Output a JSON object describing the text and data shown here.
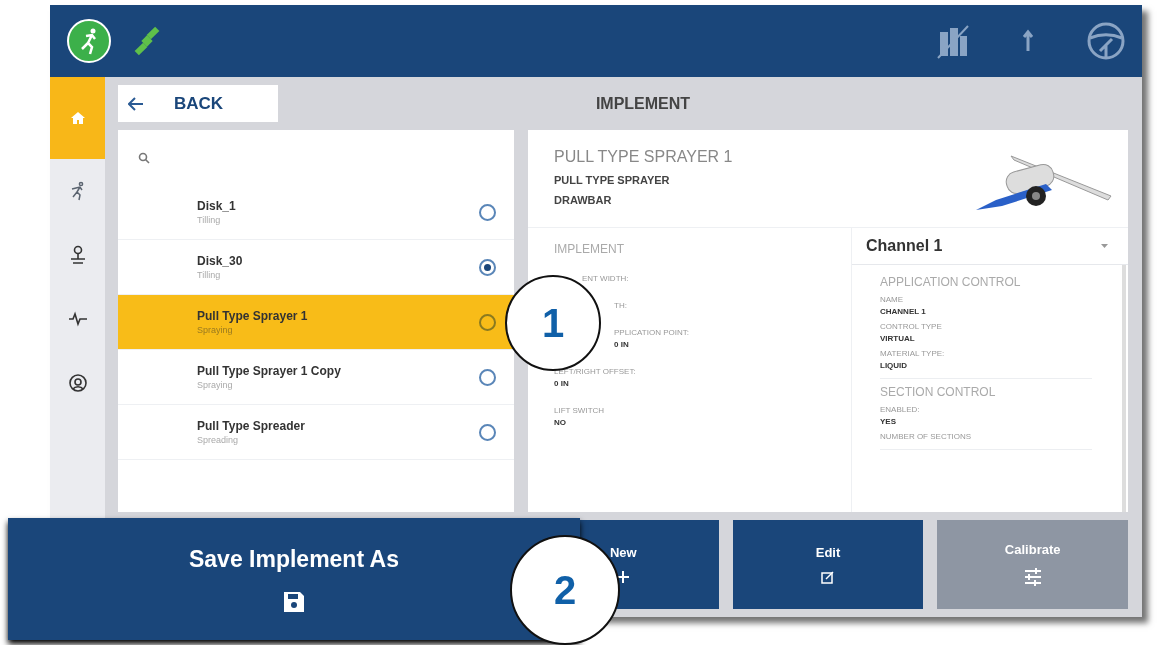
{
  "nav": {
    "back": "BACK",
    "title": "IMPLEMENT"
  },
  "sidebar": [
    {
      "kind": "home",
      "selected": true
    },
    {
      "kind": "operator",
      "selected": false
    },
    {
      "kind": "field",
      "selected": false
    },
    {
      "kind": "diagnostics",
      "selected": false
    },
    {
      "kind": "help",
      "selected": false
    }
  ],
  "implements": [
    {
      "name": "Disk_1",
      "type": "Tilling",
      "selected": false,
      "checked": false
    },
    {
      "name": "Disk_30",
      "type": "Tilling",
      "selected": false,
      "checked": true
    },
    {
      "name": "Pull Type Sprayer 1",
      "type": "Spraying",
      "selected": true,
      "checked": false
    },
    {
      "name": "Pull Type Sprayer 1 Copy",
      "type": "Spraying",
      "selected": false,
      "checked": false
    },
    {
      "name": "Pull Type Spreader",
      "type": "Spreading",
      "selected": false,
      "checked": false
    }
  ],
  "detail": {
    "title": "PULL TYPE SPRAYER 1",
    "model": "PULL TYPE SPRAYER",
    "hitch": "DRAWBAR",
    "section": "IMPLEMENT",
    "fields": [
      {
        "kind": "partial",
        "label": "ENT WIDTH:"
      },
      {
        "kind": "partial",
        "label": "TH:"
      },
      {
        "kind": "partial",
        "label": "PPLICATION POINT:",
        "value": "0 IN"
      },
      {
        "kind": "full",
        "label": "LEFT/RIGHT OFFSET:",
        "value": "0 IN"
      },
      {
        "kind": "full",
        "label": "LIFT SWITCH",
        "value": "NO"
      }
    ]
  },
  "channel": {
    "selected_channel": "Channel 1",
    "groups": [
      {
        "title": "APPLICATION CONTROL",
        "fields": [
          {
            "label": "NAME",
            "value": "CHANNEL 1"
          },
          {
            "label": "CONTROL TYPE",
            "value": "VIRTUAL"
          },
          {
            "label": "MATERIAL TYPE:",
            "value": "LIQUID"
          }
        ]
      },
      {
        "title": "SECTION CONTROL",
        "fields": [
          {
            "label": "ENABLED:",
            "value": "YES"
          },
          {
            "label": "NUMBER OF SECTIONS"
          }
        ]
      }
    ]
  },
  "actions": [
    {
      "label": "New",
      "kind": "add",
      "disabled": false
    },
    {
      "label": "Edit",
      "kind": "edit",
      "disabled": false
    },
    {
      "label": "Calibrate",
      "kind": "calibrate",
      "disabled": true
    }
  ],
  "popup": {
    "label": "Save Implement As"
  },
  "callouts": [
    "1",
    "2"
  ]
}
